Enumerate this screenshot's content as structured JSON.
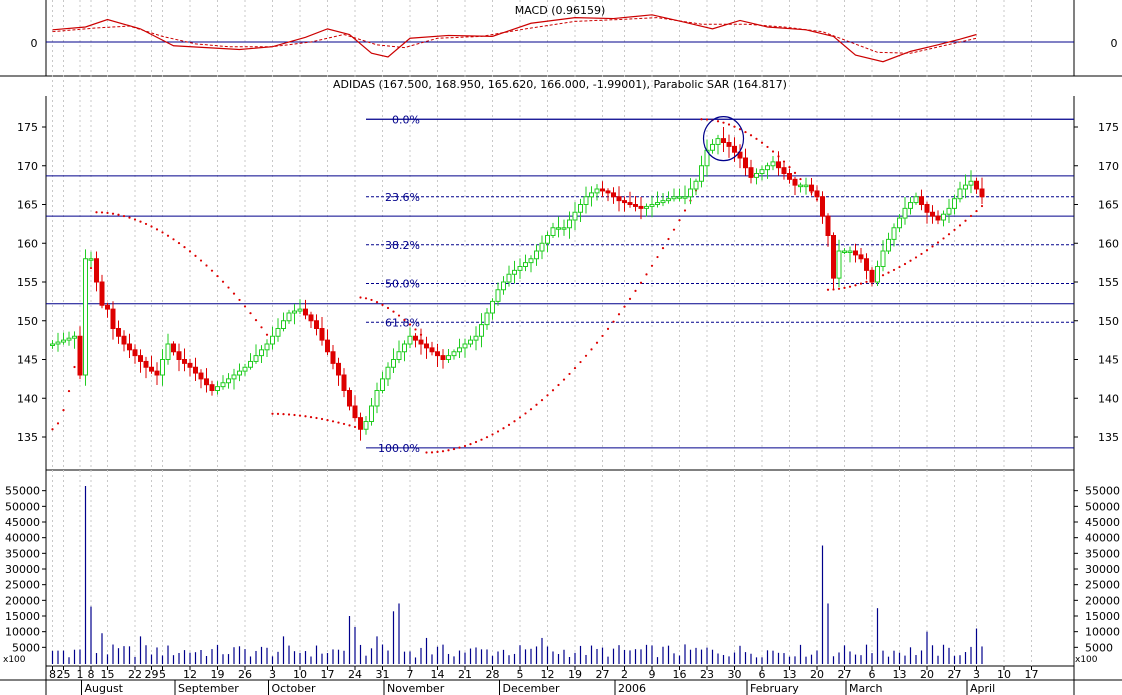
{
  "macd_panel": {
    "title": "MACD (0.96159)",
    "zero_label": "0",
    "line_color": "#cc0000",
    "zero_line_color": "#00008b"
  },
  "price_panel": {
    "title": "ADIDAS (167.500, 168.950, 165.620, 166.000, -1.99001), Parabolic SAR (164.817)"
  },
  "volume_panel": {
    "multiplier_label": "x100"
  },
  "colors": {
    "up": "#22cc22",
    "down": "#dd0000",
    "sar": "#dd0000",
    "fib": "#00008b",
    "volume": "#00008b",
    "highlight_circle": "#00008b"
  },
  "chart_data": [
    {
      "type": "candlestick",
      "title": "ADIDAS (167.500, 168.950, 165.620, 166.000, -1.99001), Parabolic SAR (164.817)",
      "ylim": [
        131,
        179
      ],
      "y_ticks": [
        135,
        140,
        145,
        150,
        155,
        160,
        165,
        170,
        175
      ],
      "x_ticks": [
        {
          "day": 0,
          "label": "8"
        },
        {
          "day": 2,
          "label": "25"
        },
        {
          "day": 5,
          "label": "1"
        },
        {
          "day": 7,
          "label": "8"
        },
        {
          "day": 10,
          "label": "15"
        },
        {
          "day": 15,
          "label": "22"
        },
        {
          "day": 18,
          "label": "29"
        },
        {
          "day": 20,
          "label": "5"
        },
        {
          "day": 25,
          "label": "12"
        },
        {
          "day": 30,
          "label": "19"
        },
        {
          "day": 35,
          "label": "26"
        },
        {
          "day": 40,
          "label": "3"
        },
        {
          "day": 45,
          "label": "10"
        },
        {
          "day": 50,
          "label": "17"
        },
        {
          "day": 55,
          "label": "24"
        },
        {
          "day": 60,
          "label": "31"
        },
        {
          "day": 65,
          "label": "7"
        },
        {
          "day": 70,
          "label": "14"
        },
        {
          "day": 75,
          "label": "21"
        },
        {
          "day": 80,
          "label": "28"
        },
        {
          "day": 85,
          "label": "5"
        },
        {
          "day": 90,
          "label": "12"
        },
        {
          "day": 95,
          "label": "19"
        },
        {
          "day": 100,
          "label": "27"
        },
        {
          "day": 104,
          "label": "2"
        },
        {
          "day": 109,
          "label": "9"
        },
        {
          "day": 114,
          "label": "16"
        },
        {
          "day": 119,
          "label": "23"
        },
        {
          "day": 124,
          "label": "30"
        },
        {
          "day": 129,
          "label": "6"
        },
        {
          "day": 134,
          "label": "13"
        },
        {
          "day": 139,
          "label": "20"
        },
        {
          "day": 144,
          "label": "27"
        },
        {
          "day": 149,
          "label": "6"
        },
        {
          "day": 154,
          "label": "13"
        },
        {
          "day": 159,
          "label": "20"
        },
        {
          "day": 164,
          "label": "27"
        },
        {
          "day": 168,
          "label": "3"
        },
        {
          "day": 173,
          "label": "10"
        },
        {
          "day": 178,
          "label": "17"
        }
      ],
      "months": [
        {
          "day": 6,
          "label": "August"
        },
        {
          "day": 23,
          "label": "September"
        },
        {
          "day": 40,
          "label": "October"
        },
        {
          "day": 61,
          "label": "November"
        },
        {
          "day": 82,
          "label": "December"
        },
        {
          "day": 103,
          "label": "2006"
        },
        {
          "day": 127,
          "label": "February"
        },
        {
          "day": 145,
          "label": "March"
        },
        {
          "day": 167,
          "label": "April"
        }
      ],
      "anchors": [
        [
          0,
          147
        ],
        [
          2,
          147.5
        ],
        [
          4,
          148
        ],
        [
          5,
          143
        ],
        [
          6,
          158
        ],
        [
          7,
          158
        ],
        [
          8,
          155
        ],
        [
          9,
          152
        ],
        [
          10,
          151.5
        ],
        [
          11,
          149
        ],
        [
          13,
          147
        ],
        [
          15,
          145.5
        ],
        [
          17,
          144
        ],
        [
          19,
          143
        ],
        [
          21,
          147
        ],
        [
          23,
          145
        ],
        [
          25,
          144
        ],
        [
          27,
          142.5
        ],
        [
          29,
          141
        ],
        [
          31,
          142
        ],
        [
          33,
          143
        ],
        [
          35,
          144
        ],
        [
          37,
          145.5
        ],
        [
          39,
          147
        ],
        [
          41,
          149
        ],
        [
          43,
          151
        ],
        [
          45,
          151.5
        ],
        [
          47,
          150
        ],
        [
          48,
          149
        ],
        [
          50,
          146
        ],
        [
          52,
          143
        ],
        [
          54,
          139
        ],
        [
          56,
          136
        ],
        [
          57,
          137
        ],
        [
          59,
          141
        ],
        [
          61,
          144
        ],
        [
          63,
          146
        ],
        [
          65,
          148
        ],
        [
          67,
          147
        ],
        [
          69,
          146
        ],
        [
          71,
          145
        ],
        [
          73,
          146
        ],
        [
          75,
          147
        ],
        [
          77,
          148
        ],
        [
          79,
          151
        ],
        [
          81,
          154
        ],
        [
          83,
          156
        ],
        [
          85,
          157
        ],
        [
          87,
          158
        ],
        [
          89,
          160
        ],
        [
          91,
          162
        ],
        [
          93,
          162
        ],
        [
          95,
          164
        ],
        [
          97,
          166
        ],
        [
          99,
          167
        ],
        [
          101,
          166.5
        ],
        [
          103,
          165.5
        ],
        [
          105,
          165
        ],
        [
          107,
          164.5
        ],
        [
          109,
          165
        ],
        [
          111,
          165.5
        ],
        [
          113,
          166
        ],
        [
          115,
          166
        ],
        [
          117,
          168
        ],
        [
          119,
          172
        ],
        [
          121,
          173.5
        ],
        [
          123,
          172.5
        ],
        [
          125,
          171
        ],
        [
          127,
          168.5
        ],
        [
          129,
          169.5
        ],
        [
          131,
          170.5
        ],
        [
          133,
          169
        ],
        [
          135,
          167.5
        ],
        [
          137,
          167.5
        ],
        [
          139,
          166
        ],
        [
          141,
          161
        ],
        [
          142,
          155.5
        ],
        [
          143,
          159
        ],
        [
          145,
          159
        ],
        [
          147,
          158
        ],
        [
          149,
          155
        ],
        [
          151,
          159
        ],
        [
          153,
          162
        ],
        [
          155,
          164.5
        ],
        [
          157,
          166
        ],
        [
          159,
          164
        ],
        [
          161,
          163
        ],
        [
          163,
          164.5
        ],
        [
          165,
          167
        ],
        [
          167,
          168
        ],
        [
          169,
          166
        ]
      ],
      "candles_range": [
        0,
        169
      ],
      "sar_segments": [
        {
          "from": 0,
          "to": 7,
          "start": 136,
          "accel": 0.7
        },
        {
          "from": 8,
          "to": 39,
          "start": 164,
          "accel": -0.9
        },
        {
          "from": 40,
          "to": 55,
          "start": 138,
          "accel": 0.8
        },
        {
          "from": 56,
          "to": 67,
          "start": 153,
          "accel": -0.6
        },
        {
          "from": 68,
          "to": 117,
          "start": 133,
          "accel": 0.9
        },
        {
          "from": 118,
          "to": 140,
          "start": 176,
          "accel": -0.9
        },
        {
          "from": 141,
          "to": 169,
          "start": 154,
          "accel": 0.7
        }
      ],
      "horizontal_lines": [
        176,
        168.7,
        163.5,
        152.2
      ],
      "fibonacci_levels": [
        {
          "label": "0.0%",
          "value": 176
        },
        {
          "label": "23.6%",
          "value": 166
        },
        {
          "label": "38.2%",
          "value": 159.8
        },
        {
          "label": "50.0%",
          "value": 154.8
        },
        {
          "label": "61.8%",
          "value": 149.8
        },
        {
          "label": "100.0%",
          "value": 133.6
        }
      ],
      "fib_start_day": 57,
      "highlight_day": 122,
      "highlight_value": 173.5
    },
    {
      "type": "line",
      "title": "MACD (0.96159)",
      "ylim": [
        -3.2,
        3.2
      ],
      "macd": [
        [
          0,
          1.3
        ],
        [
          6,
          1.6
        ],
        [
          10,
          2.4
        ],
        [
          16,
          1.4
        ],
        [
          22,
          -0.4
        ],
        [
          28,
          -0.6
        ],
        [
          34,
          -0.8
        ],
        [
          40,
          -0.5
        ],
        [
          46,
          0.5
        ],
        [
          50,
          1.4
        ],
        [
          54,
          0.8
        ],
        [
          58,
          -1.2
        ],
        [
          61,
          -1.6
        ],
        [
          65,
          0.4
        ],
        [
          72,
          0.7
        ],
        [
          80,
          0.6
        ],
        [
          87,
          2.0
        ],
        [
          95,
          2.6
        ],
        [
          102,
          2.5
        ],
        [
          109,
          2.9
        ],
        [
          115,
          2.1
        ],
        [
          120,
          1.4
        ],
        [
          125,
          2.3
        ],
        [
          130,
          1.6
        ],
        [
          137,
          1.3
        ],
        [
          142,
          0.6
        ],
        [
          146,
          -1.4
        ],
        [
          151,
          -2.1
        ],
        [
          156,
          -1.0
        ],
        [
          161,
          -0.3
        ],
        [
          165,
          0.3
        ],
        [
          168,
          0.8
        ]
      ],
      "signal": [
        [
          0,
          1.1
        ],
        [
          8,
          1.5
        ],
        [
          14,
          1.7
        ],
        [
          20,
          0.6
        ],
        [
          26,
          -0.2
        ],
        [
          32,
          -0.5
        ],
        [
          40,
          -0.5
        ],
        [
          47,
          0.0
        ],
        [
          53,
          0.8
        ],
        [
          59,
          -0.3
        ],
        [
          64,
          -0.6
        ],
        [
          70,
          0.4
        ],
        [
          78,
          0.6
        ],
        [
          86,
          1.4
        ],
        [
          95,
          2.2
        ],
        [
          103,
          2.4
        ],
        [
          110,
          2.6
        ],
        [
          118,
          1.9
        ],
        [
          126,
          1.9
        ],
        [
          133,
          1.6
        ],
        [
          140,
          1.1
        ],
        [
          145,
          0.0
        ],
        [
          150,
          -1.1
        ],
        [
          156,
          -1.2
        ],
        [
          162,
          -0.4
        ],
        [
          168,
          0.4
        ]
      ]
    },
    {
      "type": "bar",
      "title": "",
      "ylim": [
        0,
        60000
      ],
      "y_ticks": [
        5000,
        10000,
        15000,
        20000,
        25000,
        30000,
        35000,
        40000,
        45000,
        50000,
        55000
      ],
      "tick_labels": [
        "5000",
        "10000",
        "15000",
        "20000",
        "25000",
        "30000",
        "35000",
        "40000",
        "45000",
        "50000",
        "55000"
      ],
      "baseline": 3500,
      "spikes": [
        {
          "day": 6,
          "value": 56500
        },
        {
          "day": 7,
          "value": 18000
        },
        {
          "day": 9,
          "value": 9500
        },
        {
          "day": 16,
          "value": 8500
        },
        {
          "day": 42,
          "value": 8500
        },
        {
          "day": 54,
          "value": 15000
        },
        {
          "day": 55,
          "value": 11500
        },
        {
          "day": 59,
          "value": 8500
        },
        {
          "day": 62,
          "value": 16500
        },
        {
          "day": 63,
          "value": 19000
        },
        {
          "day": 68,
          "value": 8000
        },
        {
          "day": 89,
          "value": 8000
        },
        {
          "day": 140,
          "value": 37500
        },
        {
          "day": 141,
          "value": 19000
        },
        {
          "day": 150,
          "value": 17500
        },
        {
          "day": 159,
          "value": 10000
        },
        {
          "day": 168,
          "value": 11000
        }
      ]
    }
  ]
}
